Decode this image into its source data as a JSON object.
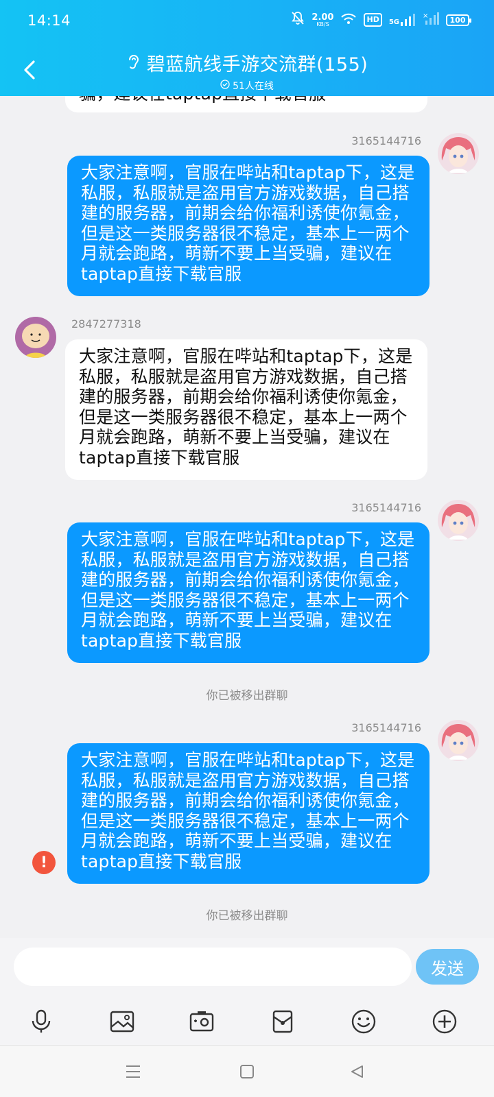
{
  "status_bar": {
    "time": "14:14",
    "net_speed_value": "2.00",
    "net_speed_unit": "KB/S",
    "hd_label": "HD",
    "network_label": "5G",
    "battery": "100"
  },
  "header": {
    "title": "碧蓝航线手游交流群(155)",
    "online": "51人在线"
  },
  "messages": [
    {
      "type": "out",
      "sender": "3165144716",
      "text": "大家注意啊，官服在哔站和taptap下，这是私服，私服就是盗用官方游戏数据，自己搭建的服务器，前期会给你福利诱使你氪金，但是这一类服务器很不稳定，基本上一两个月就会跑路，萌新不要上当受骗，建议在taptap直接下载官服"
    },
    {
      "type": "in",
      "sender": "2847277318",
      "text": "大家注意啊，官服在哔站和taptap下，这是私服，私服就是盗用官方游戏数据，自己搭建的服务器，前期会给你福利诱使你氪金，但是这一类服务器很不稳定，基本上一两个月就会跑路，萌新不要上当受骗，建议在taptap直接下载官服"
    },
    {
      "type": "out",
      "sender": "3165144716",
      "text": "大家注意啊，官服在哔站和taptap下，这是私服，私服就是盗用官方游戏数据，自己搭建的服务器，前期会给你福利诱使你氪金，但是这一类服务器很不稳定，基本上一两个月就会跑路，萌新不要上当受骗，建议在taptap直接下载官服"
    },
    {
      "type": "out",
      "sender": "3165144716",
      "text": "大家注意啊，官服在哔站和taptap下，这是私服，私服就是盗用官方游戏数据，自己搭建的服务器，前期会给你福利诱使你氪金，但是这一类服务器很不稳定，基本上一两个月就会跑路，萌新不要上当受骗，建议在taptap直接下载官服"
    }
  ],
  "partial_top_text": "骗，建议在taptap直接下载官服",
  "system_notes": [
    "你已被移出群聊",
    "你已被移出群聊"
  ],
  "error_mark": "!",
  "input": {
    "placeholder": "",
    "value": ""
  },
  "send_label": "发送",
  "toolbar_icons": [
    "microphone-icon",
    "image-icon",
    "camera-icon",
    "red-packet-icon",
    "emoji-icon",
    "plus-icon"
  ],
  "colors": {
    "header_start": "#14c3f4",
    "header_end": "#1aa4f6",
    "bubble_out": "#0b99ff",
    "bubble_in": "#ffffff",
    "send_button": "#6fc3f6",
    "error": "#f2553d"
  }
}
